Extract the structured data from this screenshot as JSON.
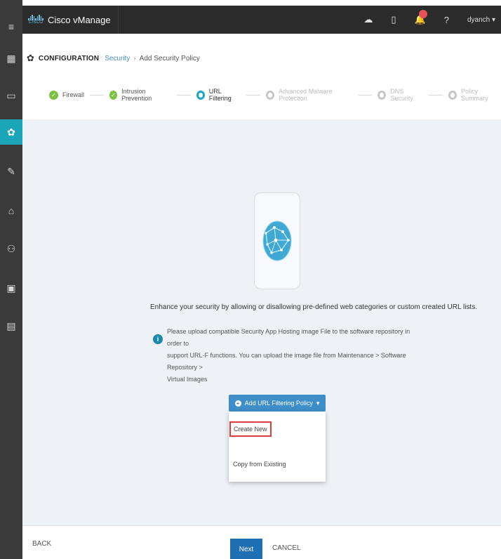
{
  "app": {
    "name": "Cisco vManage",
    "logo_word": "CISCO",
    "user": "dyanch ▾"
  },
  "sidebar": {
    "items": [
      {
        "icon": "menu-icon",
        "glyph": "≡"
      },
      {
        "icon": "dashboard-icon",
        "glyph": "▦"
      },
      {
        "icon": "monitor-icon",
        "glyph": "▭"
      },
      {
        "icon": "configuration-gear-icon",
        "glyph": "✿",
        "active": true
      },
      {
        "icon": "tools-wrench-icon",
        "glyph": "✎"
      },
      {
        "icon": "maintenance-icon",
        "glyph": "⌂"
      },
      {
        "icon": "administration-users-icon",
        "glyph": "⚇"
      },
      {
        "icon": "vanalytics-icon",
        "glyph": "▣"
      },
      {
        "icon": "reports-icon",
        "glyph": "▤"
      }
    ]
  },
  "breadcrumb": {
    "section": "CONFIGURATION",
    "link": "Security",
    "separator": "›",
    "current": "Add Security Policy"
  },
  "steps": [
    {
      "label": "Firewall",
      "state": "done"
    },
    {
      "label": "Intrusion Prevention",
      "state": "done"
    },
    {
      "label": "URL Filtering",
      "state": "current"
    },
    {
      "label": "Advanced Malware Protection",
      "state": "todo"
    },
    {
      "label": "DNS Security",
      "state": "todo"
    },
    {
      "label": "Policy Summary",
      "state": "todo"
    }
  ],
  "main": {
    "description": "Enhance your security by allowing or disallowing pre-defined web categories or custom created URL lists.",
    "info_lines": [
      "Please upload compatible Security App Hosting image File to the software repository in order to",
      "support URL-F functions. You can upload the image file from Maintenance > Software Repository >",
      "Virtual Images"
    ],
    "add_button": "Add URL Filtering Policy",
    "menu": {
      "create_new": "Create New",
      "copy_existing": "Copy from Existing"
    }
  },
  "footer": {
    "back": "BACK",
    "next": "Next",
    "cancel": "CANCEL"
  },
  "colors": {
    "accent": "#1aa6b7",
    "primary_button": "#1f6fb5",
    "done_step": "#7cc242",
    "highlight_box": "#e03a3a"
  }
}
